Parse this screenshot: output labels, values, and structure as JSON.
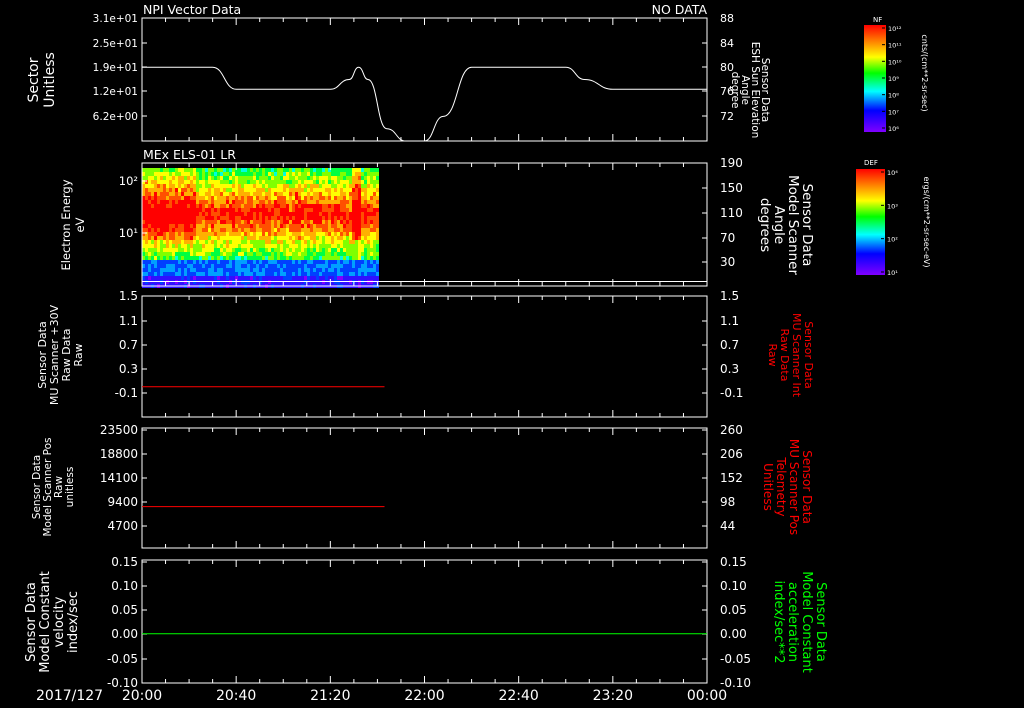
{
  "colors": {
    "background": "#000000",
    "axes": "#ffffff",
    "red_trace": "#ff0000",
    "green_trace": "#00ff00"
  },
  "time_axis": {
    "date_label": "2017/127",
    "ticks": [
      "20:00",
      "20:40",
      "21:20",
      "22:00",
      "22:40",
      "23:20",
      "00:00"
    ],
    "start": "2017-05-07T20:00",
    "end": "2017-05-08T00:00"
  },
  "colorbars": [
    {
      "id": "nf",
      "title": "NF",
      "unit": "cnts/(cm**2-sr-sec)",
      "tick_labels": [
        "10¹²",
        "10¹¹",
        "10¹⁰",
        "10⁹",
        "10⁸",
        "10⁷",
        "10⁶"
      ]
    },
    {
      "id": "def",
      "title": "DEF",
      "unit": "ergs/(cm**2-sr-sec-eV)",
      "tick_labels": [
        "10⁴",
        "10³",
        "10²",
        "10¹"
      ]
    }
  ],
  "chart_data": [
    {
      "type": "line",
      "title": "NPI Vector Data",
      "status": "NO DATA",
      "ylabel_left": [
        "Sector",
        "Unitless"
      ],
      "yticks_left": [
        "3.1e+01",
        "2.5e+01",
        "1.9e+01",
        "1.2e+01",
        "6.2e+00"
      ],
      "ylabel_right": [
        "Sensor Data",
        "ESH Sun Elevation",
        "Angle",
        "degree"
      ],
      "yticks_right": [
        "88",
        "84",
        "80",
        "76",
        "72"
      ],
      "ylim_right": [
        68,
        88
      ],
      "series": [
        {
          "axis": "right",
          "x": [
            "20:00",
            "20:30",
            "20:40",
            "20:52",
            "21:20",
            "21:28",
            "21:32",
            "21:36",
            "21:44",
            "21:52",
            "22:00",
            "22:08",
            "22:20",
            "22:40",
            "23:00",
            "23:08",
            "23:20",
            "00:00"
          ],
          "values": [
            80.0,
            80.0,
            76.4,
            76.4,
            76.4,
            78.0,
            80.0,
            78.0,
            70.0,
            67.0,
            67.0,
            72.0,
            80.0,
            80.0,
            80.0,
            78.0,
            76.4,
            76.4
          ]
        }
      ]
    },
    {
      "type": "heatmap",
      "title": "MEx ELS-01 LR",
      "ylabel_left": [
        "Electron Energy",
        "eV"
      ],
      "yticks_left": [
        "10²",
        "10¹"
      ],
      "ylabel_right": [
        "Sensor Data",
        "Model Scanner",
        "Angle",
        "degrees"
      ],
      "yticks_right": [
        "190",
        "150",
        "110",
        "70",
        "30"
      ],
      "ylim_right": [
        0,
        190
      ],
      "data_coverage": [
        "20:00",
        "21:40"
      ],
      "colorbar": "def",
      "series": [
        {
          "axis": "right",
          "x": [
            "20:00",
            "00:00"
          ],
          "values": [
            7,
            7
          ]
        }
      ]
    },
    {
      "type": "line",
      "ylabel_left": [
        "Sensor Data",
        "MU Scanner +30V",
        "Raw Data",
        "Raw"
      ],
      "yticks_left": [
        "1.5",
        "1.1",
        "0.7",
        "0.3",
        "-0.1"
      ],
      "ylim_left": [
        -0.5,
        1.5
      ],
      "ylabel_right": [
        "Sensor Data",
        "MU Scanner Int",
        "Raw Data",
        "Raw"
      ],
      "yticks_right": [
        "1.5",
        "1.1",
        "0.7",
        "0.3",
        "-0.1"
      ],
      "ylabel_right_color": "#ff0000",
      "series": [
        {
          "axis": "left",
          "color": "#ff0000",
          "x": [
            "20:00",
            "21:43"
          ],
          "values": [
            0.0,
            0.0
          ]
        }
      ]
    },
    {
      "type": "line",
      "ylabel_left": [
        "Sensor Data",
        "Model Scanner Pos",
        "Raw",
        "unitless"
      ],
      "yticks_left": [
        "23500",
        "18800",
        "14100",
        "9400",
        "4700"
      ],
      "ylim_left": [
        0,
        23500
      ],
      "ylabel_right": [
        "Sensor Data",
        "MU Scanner Pos",
        "Telemetry",
        "Unitless"
      ],
      "yticks_right": [
        "260",
        "206",
        "152",
        "98",
        "44"
      ],
      "ylabel_right_color": "#ff0000",
      "series": [
        {
          "axis": "left",
          "color": "#ff0000",
          "x": [
            "20:00",
            "21:43"
          ],
          "values": [
            8100,
            8100
          ]
        }
      ]
    },
    {
      "type": "line",
      "ylabel_left": [
        "Sensor Data",
        "Model Constant",
        "velocity",
        "index/sec"
      ],
      "yticks_left": [
        "0.15",
        "0.10",
        "0.05",
        "0.00",
        "-0.05",
        "-0.10"
      ],
      "ylim_left": [
        -0.1,
        0.15
      ],
      "ylabel_right": [
        "Sensor Data",
        "Model Constant",
        "acceleration",
        "index/sec**2"
      ],
      "yticks_right": [
        "0.15",
        "0.10",
        "0.05",
        "0.00",
        "-0.05",
        "-0.10"
      ],
      "ylabel_right_color": "#00ff00",
      "series": [
        {
          "axis": "left",
          "color": "#00ff00",
          "x": [
            "20:00",
            "00:00"
          ],
          "values": [
            0.0,
            0.0
          ]
        }
      ]
    }
  ]
}
